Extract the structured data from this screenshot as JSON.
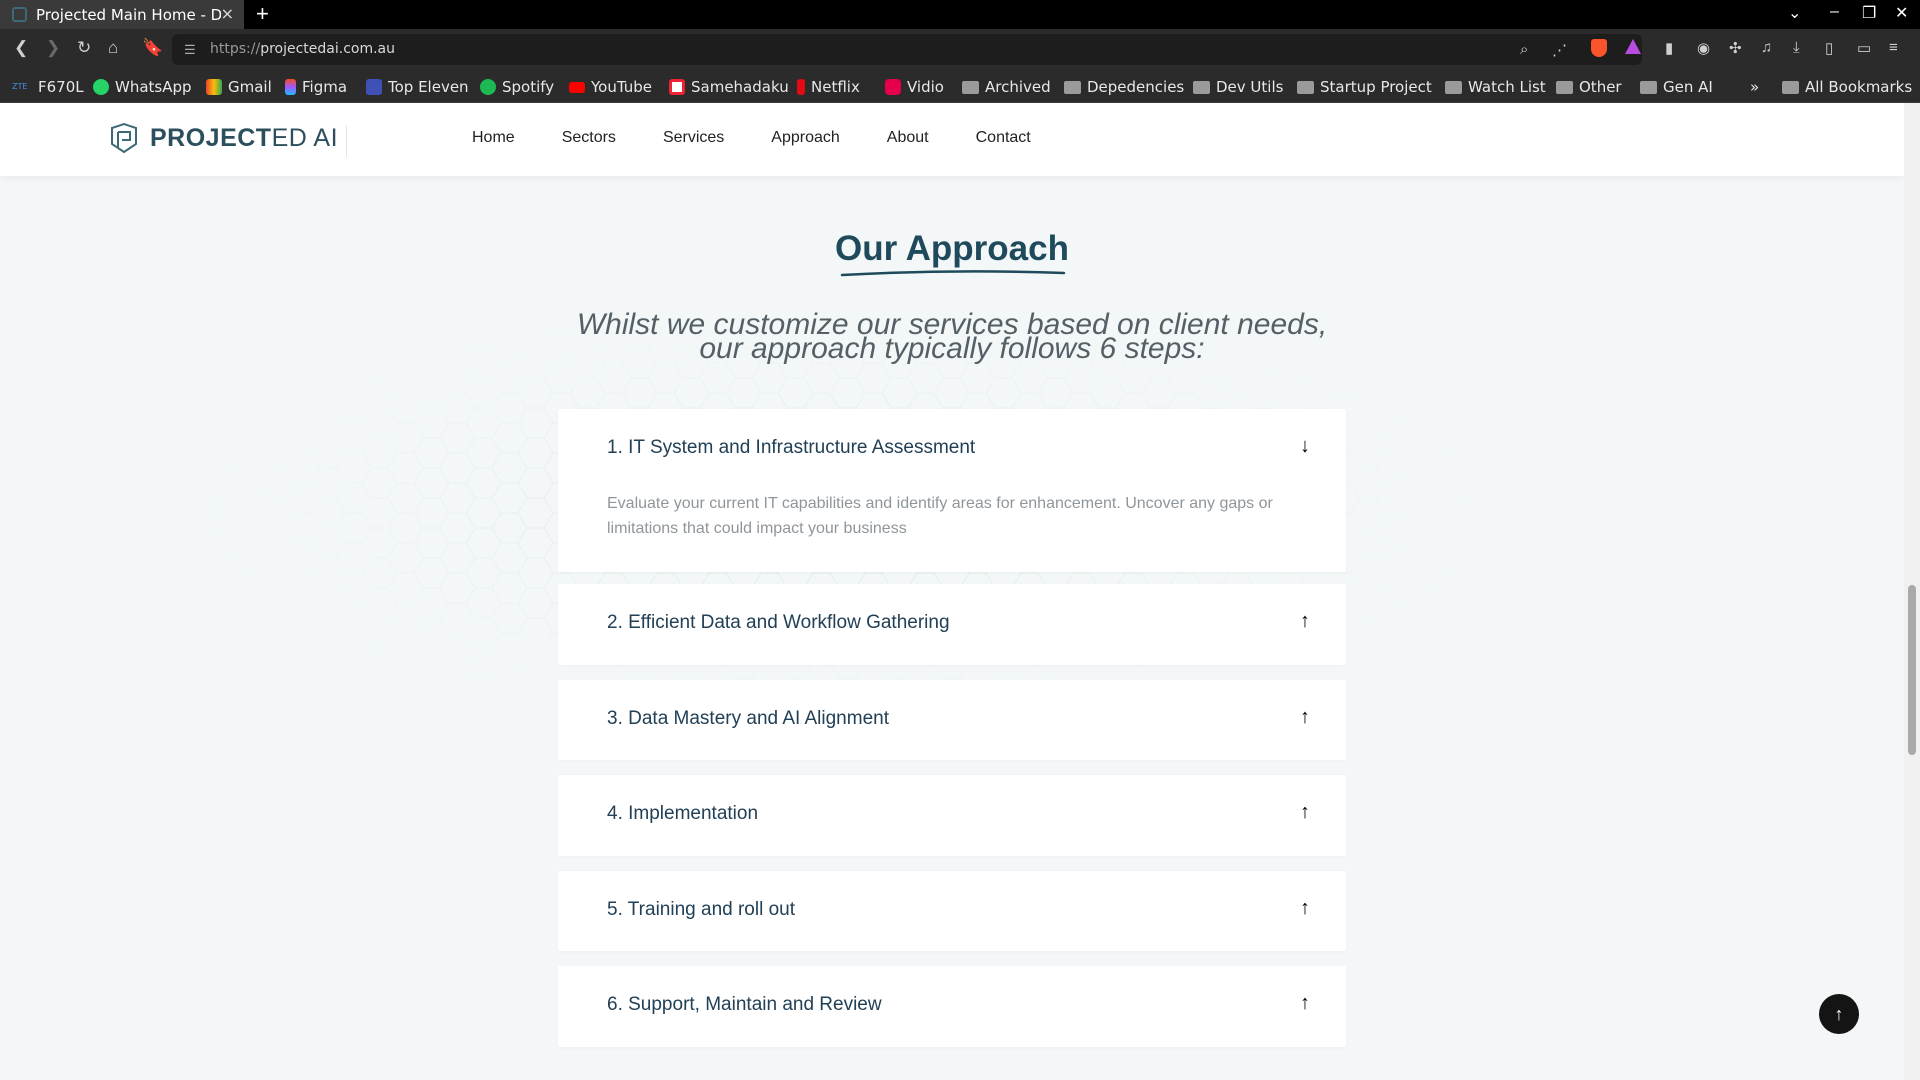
{
  "browser": {
    "tab_title": "Projected Main Home - Dev",
    "tab_close": "×",
    "new_tab": "+",
    "url_scheme": "https://",
    "url_host": "projectedai.com.au",
    "bookmarks": [
      {
        "label": "F670L",
        "icon_color": "#1565c0"
      },
      {
        "label": "WhatsApp",
        "icon_color": "#25d366"
      },
      {
        "label": "Gmail",
        "icon_color": "#ea4335"
      },
      {
        "label": "Figma",
        "icon_color": "#a259ff"
      },
      {
        "label": "Top Eleven",
        "icon_color": "#3f51b5"
      },
      {
        "label": "Spotify",
        "icon_color": "#1db954"
      },
      {
        "label": "YouTube",
        "icon_color": "#ff0000"
      },
      {
        "label": "Samehadaku",
        "icon_color": "#ffffff"
      },
      {
        "label": "Netflix",
        "icon_color": "#e50914"
      },
      {
        "label": "Vidio",
        "icon_color": "#e6004c"
      }
    ],
    "folders": [
      "Archived",
      "Depedencies",
      "Dev Utils",
      "Startup Project",
      "Watch List",
      "Other",
      "Gen AI"
    ],
    "overflow": "»",
    "all_bookmarks": "All Bookmarks"
  },
  "site": {
    "logo_text_bold": "PROJECT",
    "logo_text_light": "ED AI",
    "nav": [
      "Home",
      "Sectors",
      "Services",
      "Approach",
      "About",
      "Contact"
    ]
  },
  "section": {
    "title": "Our Approach",
    "subtitle_line1": "Whilst we customize our services based on client needs,",
    "subtitle_line2": "our approach typically follows 6 steps:"
  },
  "steps": [
    {
      "title": "1. IT System and Infrastructure Assessment",
      "body": "Evaluate your current IT capabilities and identify areas for enhancement. Uncover any gaps or limitations that could impact your business",
      "arrow": "↓",
      "expanded": true
    },
    {
      "title": "2. Efficient Data and Workflow Gathering",
      "arrow": "↑",
      "expanded": false
    },
    {
      "title": "3. Data Mastery and AI Alignment",
      "arrow": "↑",
      "expanded": false
    },
    {
      "title": "4. Implementation",
      "arrow": "↑",
      "expanded": false
    },
    {
      "title": "5. Training and roll out",
      "arrow": "↑",
      "expanded": false
    },
    {
      "title": "6. Support, Maintain and Review",
      "arrow": "↑",
      "expanded": false
    }
  ],
  "scroll_top_icon": "↑"
}
